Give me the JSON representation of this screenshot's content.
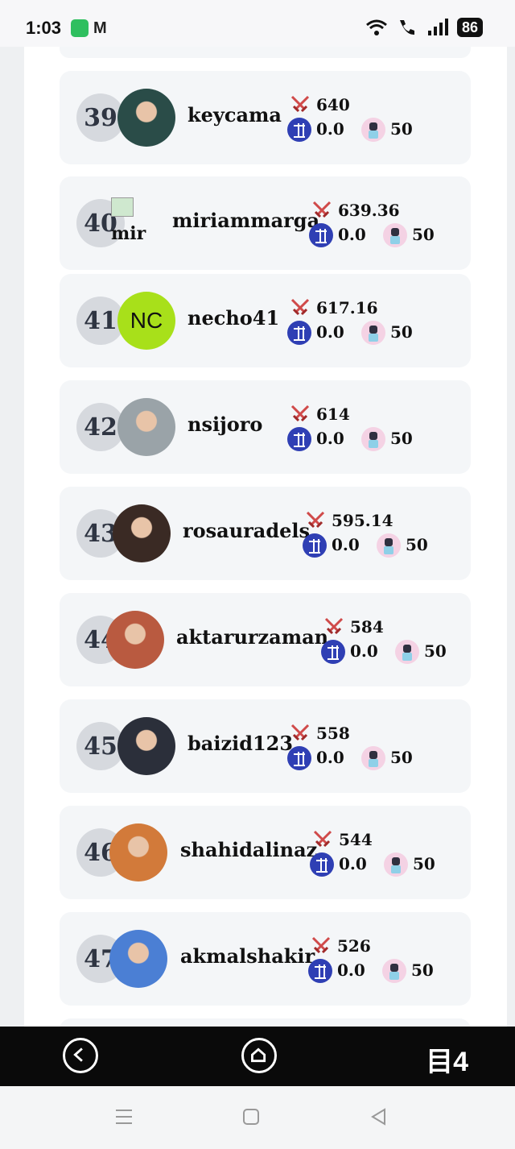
{
  "status": {
    "time": "1:03",
    "battery": "86"
  },
  "leaderboard": [
    {
      "rank": "39",
      "name": "keycama",
      "score": "640",
      "steem": "0.0",
      "stat": "50",
      "avatar": "photo",
      "avatar_color": "#2a4c48"
    },
    {
      "rank": "40",
      "name": "miriammarga",
      "score": "639.36",
      "steem": "0.0",
      "stat": "50",
      "avatar": "broken",
      "avatar_alt": "mir"
    },
    {
      "rank": "41",
      "name": "necho41",
      "score": "617.16",
      "steem": "0.0",
      "stat": "50",
      "avatar": "initials",
      "initials": "NC",
      "avatar_color": "#a8e01a"
    },
    {
      "rank": "42",
      "name": "nsijoro",
      "score": "614",
      "steem": "0.0",
      "stat": "50",
      "avatar": "photo",
      "avatar_color": "#9aa3a8"
    },
    {
      "rank": "43",
      "name": "rosauradels",
      "score": "595.14",
      "steem": "0.0",
      "stat": "50",
      "avatar": "photo",
      "avatar_color": "#3a2a24"
    },
    {
      "rank": "44",
      "name": "aktarurzaman",
      "score": "584",
      "steem": "0.0",
      "stat": "50",
      "avatar": "photo",
      "avatar_color": "#b95a40"
    },
    {
      "rank": "45",
      "name": "baizid123",
      "score": "558",
      "steem": "0.0",
      "stat": "50",
      "avatar": "photo",
      "avatar_color": "#2b2f3a"
    },
    {
      "rank": "46",
      "name": "shahidalinaz",
      "score": "544",
      "steem": "0.0",
      "stat": "50",
      "avatar": "photo",
      "avatar_color": "#d27a3a"
    },
    {
      "rank": "47",
      "name": "akmalshakir",
      "score": "526",
      "steem": "0.0",
      "stat": "50",
      "avatar": "photo",
      "avatar_color": "#4b7fd4"
    }
  ],
  "nav": {
    "brand": "目4"
  }
}
